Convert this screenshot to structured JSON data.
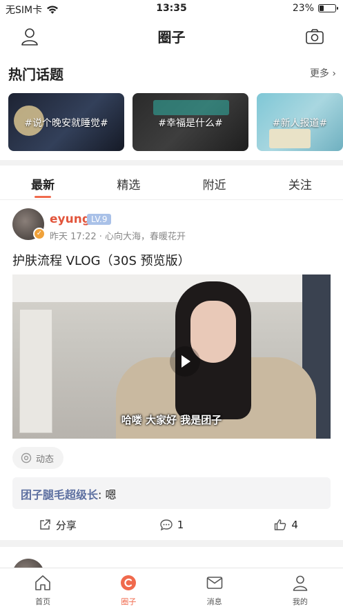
{
  "status_bar": {
    "carrier": "无SIM卡",
    "time": "13:35",
    "battery": "23%"
  },
  "nav": {
    "title": "圈子"
  },
  "hot_topics": {
    "heading": "热门话题",
    "more": "更多 ›",
    "items": [
      {
        "label": "#说个晚安就睡觉#"
      },
      {
        "label": "#幸福是什么#"
      },
      {
        "label": "#新人报道#"
      }
    ]
  },
  "tabs": [
    {
      "label": "最新",
      "active": true
    },
    {
      "label": "精选",
      "active": false
    },
    {
      "label": "附近",
      "active": false
    },
    {
      "label": "关注",
      "active": false
    }
  ],
  "post": {
    "username": "eyung",
    "level": "LV.9",
    "meta": "昨天 17:22 · 心向大海，春暖花开",
    "title": "护肤流程 VLOG（30S 预览版）",
    "video_subtitle": "哈喽 大家好 我是团子",
    "tag": "动态",
    "comment_user": "团子腿毛超级长",
    "comment_text": ": 嗯",
    "share_label": "分享",
    "comment_count": "1",
    "like_count": "4"
  },
  "tabbar": [
    {
      "label": "首页",
      "icon": "home-icon"
    },
    {
      "label": "圈子",
      "icon": "circle-icon"
    },
    {
      "label": "消息",
      "icon": "message-icon"
    },
    {
      "label": "我的",
      "icon": "profile-icon"
    }
  ],
  "colors": {
    "accent": "#f06a4d",
    "username": "#e2553c",
    "comment_user": "#5c6fa0",
    "level_badge": "#a9c1e8"
  }
}
